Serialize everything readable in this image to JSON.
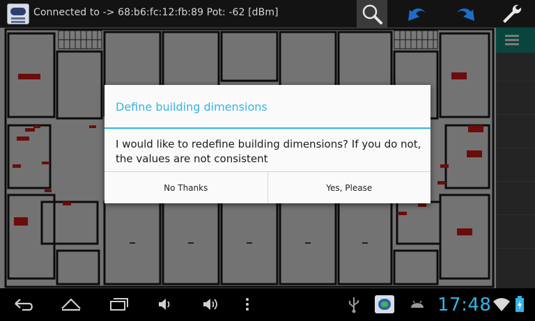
{
  "status_bar": {
    "connection_text": "Connected to -> 68:b6:fc:12:fb:89 Pot: -62 [dBm]"
  },
  "toolbar": {
    "icons": [
      "wifi-app-icon",
      "search-icon",
      "undo-icon",
      "redo-icon",
      "wrench-icon"
    ]
  },
  "side_panel": {
    "menu_icon": "menu-icon",
    "accent": "#14907f"
  },
  "dialog": {
    "title": "Define building dimensions",
    "message": "I would like to redefine building dimensions? If you do not, the values are not consistent",
    "negative_label": "No Thanks",
    "positive_label": "Yes, Please",
    "accent": "#33b5e5"
  },
  "nav_bar": {
    "clock": "17:48",
    "icons": [
      "back-icon",
      "home-icon",
      "recent-apps-icon",
      "volume-down-icon",
      "volume-up-icon",
      "overflow-menu-icon",
      "usb-icon",
      "app-notification-icon",
      "android-debug-icon",
      "wifi-icon",
      "battery-icon"
    ]
  }
}
